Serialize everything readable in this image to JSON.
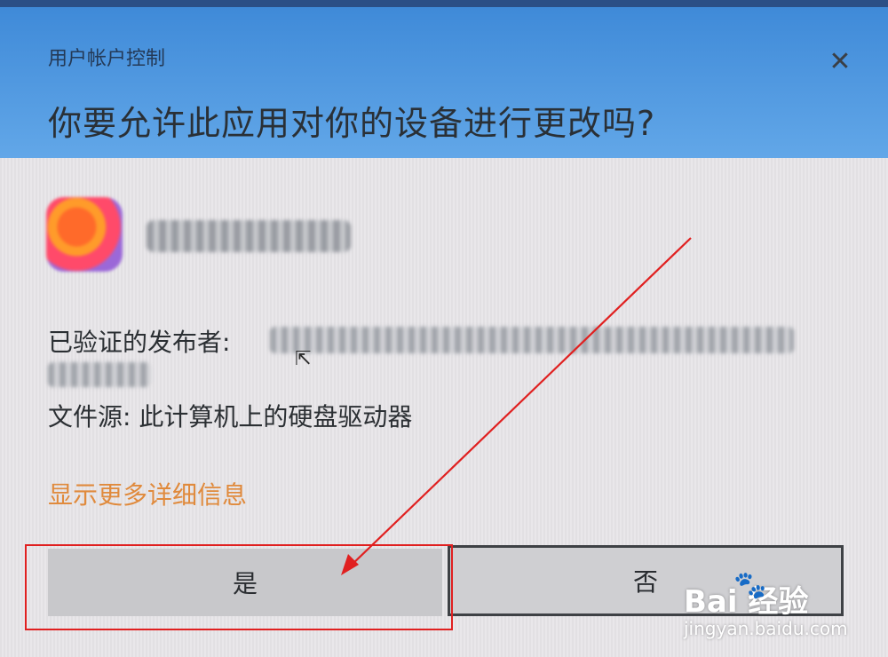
{
  "dialog": {
    "window_title": "用户帐户控制",
    "question": "你要允许此应用对你的设备进行更改吗?",
    "close_symbol": "✕",
    "app_name": "",
    "publisher_label": "已验证的发布者:",
    "publisher_value": "",
    "source_label": "文件源:",
    "source_value": "此计算机上的硬盘驱动器",
    "more_details_link": "显示更多详细信息",
    "yes_button": "是",
    "no_button": "否"
  },
  "annotation": {
    "color": "#e02020"
  },
  "watermark": {
    "logo_text": "Bai  经验",
    "paw_symbol": "🐾",
    "url": "jingyan.baidu.com"
  },
  "colors": {
    "header_blue": "#4a90d9",
    "link_orange": "#e08a3c"
  }
}
